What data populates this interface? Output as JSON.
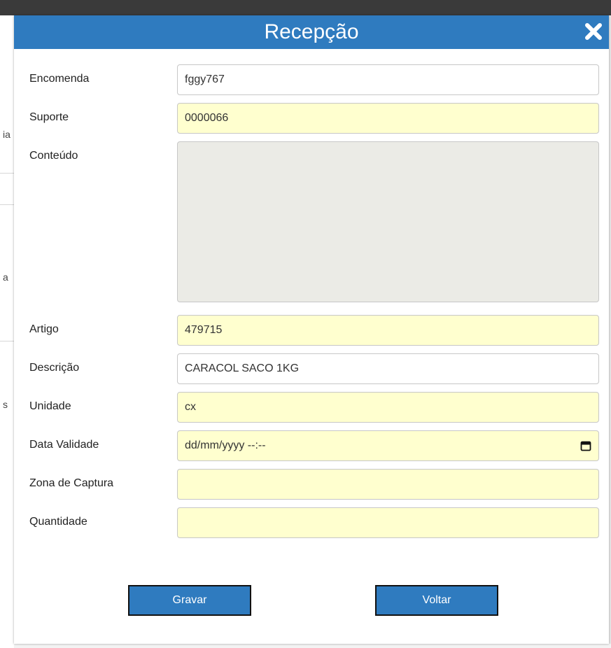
{
  "background": {
    "fragments": [
      "ia",
      "a",
      "s"
    ]
  },
  "dialog": {
    "title": "Recepção",
    "fields": {
      "encomenda": {
        "label": "Encomenda",
        "value": "fggy767"
      },
      "suporte": {
        "label": "Suporte",
        "value": "0000066"
      },
      "conteudo": {
        "label": "Conteúdo",
        "value": ""
      },
      "artigo": {
        "label": "Artigo",
        "value": "479715"
      },
      "descricao": {
        "label": "Descrição",
        "value": "CARACOL SACO 1KG"
      },
      "unidade": {
        "label": "Unidade",
        "value": "cx"
      },
      "data_validade": {
        "label": "Data Validade",
        "value": "dd/mm/yyyy --:--"
      },
      "zona_captura": {
        "label": "Zona de Captura",
        "value": ""
      },
      "quantidade": {
        "label": "Quantidade",
        "value": ""
      }
    },
    "buttons": {
      "save": "Gravar",
      "back": "Voltar"
    },
    "colors": {
      "header": "#2f7bbf",
      "highlight_field": "#ffffcf",
      "readonly_field": "#ebebe6"
    }
  }
}
